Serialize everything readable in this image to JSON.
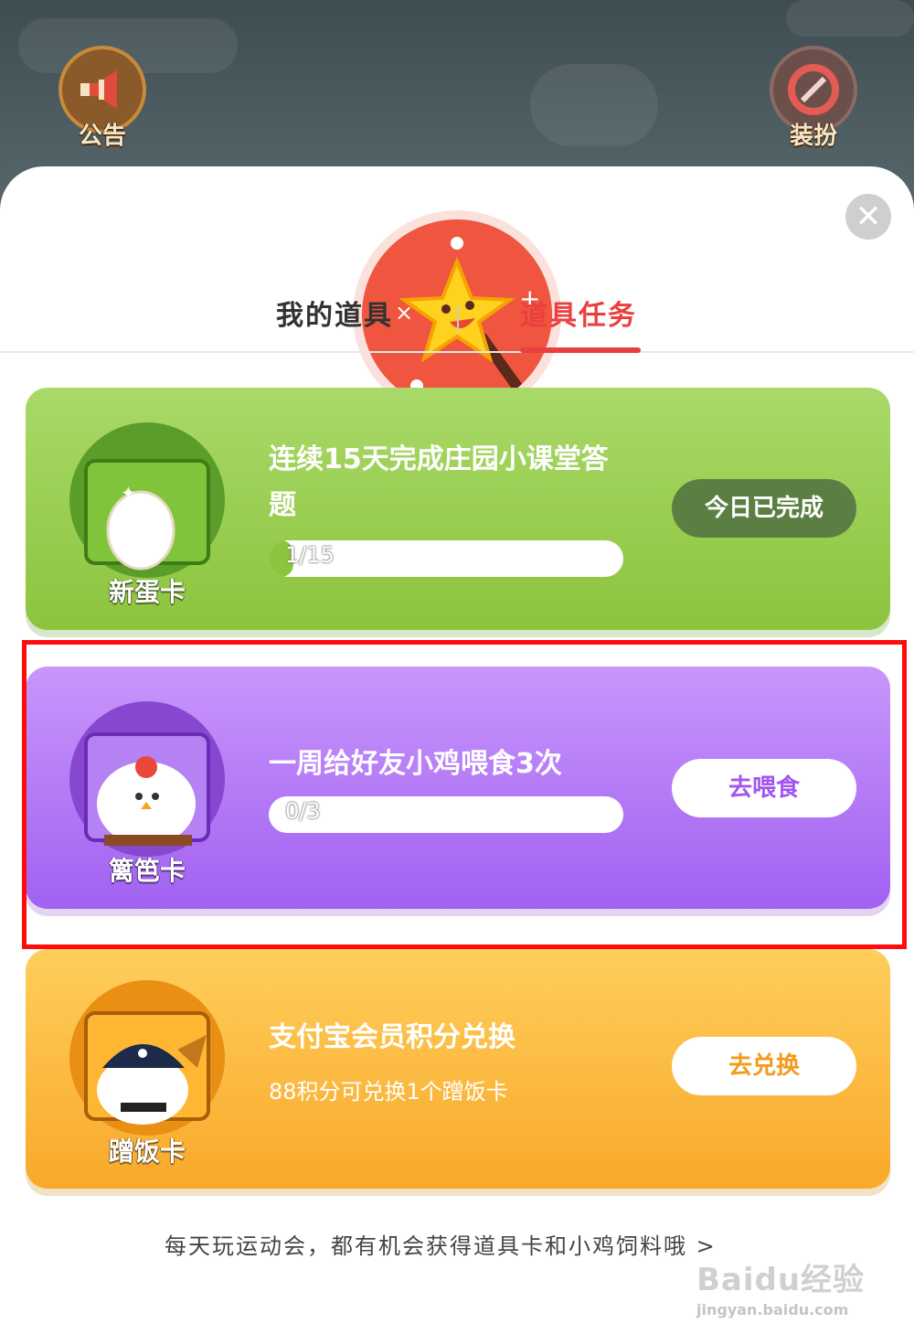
{
  "top_bar": {
    "announcement_label": "公告",
    "dressup_label": "装扮"
  },
  "tabs": [
    {
      "label": "我的道具",
      "active": false
    },
    {
      "label": "道具任务",
      "active": true
    }
  ],
  "tasks": [
    {
      "card_name": "新蛋卡",
      "title": "连续15天完成庄园小课堂答题",
      "progress_text": "1/15",
      "progress_fraction": 0.067,
      "action_label": "今日已完成",
      "color": "#8cc43e"
    },
    {
      "card_name": "篱笆卡",
      "title": "一周给好友小鸡喂食3次",
      "progress_text": "0/3",
      "progress_fraction": 0,
      "action_label": "去喂食",
      "color": "#a161f2"
    },
    {
      "card_name": "蹭饭卡",
      "title": "支付宝会员积分兑换",
      "subtitle": "88积分可兑换1个蹭饭卡",
      "action_label": "去兑换",
      "color": "#f8a92a"
    }
  ],
  "footer_text": "每天玩运动会，都有机会获得道具卡和小鸡饲料哦 >",
  "watermark": {
    "main": "Baidu经验",
    "sub": "jingyan.baidu.com"
  },
  "icons": {
    "close": "close-icon",
    "hero": "magic-star-wand-icon",
    "announcement": "megaphone-icon",
    "dressup": "mirror-icon"
  }
}
